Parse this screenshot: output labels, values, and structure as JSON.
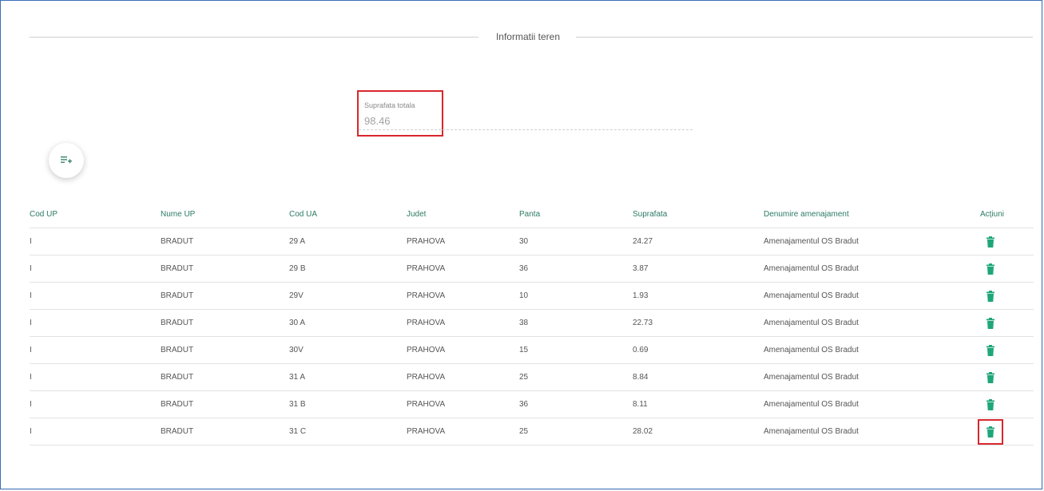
{
  "section": {
    "title": "Informatii teren"
  },
  "total_area": {
    "label": "Suprafata totala",
    "value": "98.46"
  },
  "add_button": {
    "icon": "playlist-add-icon"
  },
  "table": {
    "columns": [
      "Cod UP",
      "Nume UP",
      "Cod UA",
      "Judet",
      "Panta",
      "Suprafata",
      "Denumire amenajament",
      "Acțiuni"
    ],
    "rows": [
      {
        "cod_up": "I",
        "nume_up": "BRADUT",
        "cod_ua": "29 A",
        "judet": "PRAHOVA",
        "panta": "30",
        "suprafata": "24.27",
        "denumire": "Amenajamentul OS Bradut"
      },
      {
        "cod_up": "I",
        "nume_up": "BRADUT",
        "cod_ua": "29 B",
        "judet": "PRAHOVA",
        "panta": "36",
        "suprafata": "3.87",
        "denumire": "Amenajamentul OS Bradut"
      },
      {
        "cod_up": "I",
        "nume_up": "BRADUT",
        "cod_ua": "29V",
        "judet": "PRAHOVA",
        "panta": "10",
        "suprafata": "1.93",
        "denumire": "Amenajamentul OS Bradut"
      },
      {
        "cod_up": "I",
        "nume_up": "BRADUT",
        "cod_ua": "30 A",
        "judet": "PRAHOVA",
        "panta": "38",
        "suprafata": "22.73",
        "denumire": "Amenajamentul OS Bradut"
      },
      {
        "cod_up": "I",
        "nume_up": "BRADUT",
        "cod_ua": "30V",
        "judet": "PRAHOVA",
        "panta": "15",
        "suprafata": "0.69",
        "denumire": "Amenajamentul OS Bradut"
      },
      {
        "cod_up": "I",
        "nume_up": "BRADUT",
        "cod_ua": "31 A",
        "judet": "PRAHOVA",
        "panta": "25",
        "suprafata": "8.84",
        "denumire": "Amenajamentul OS Bradut"
      },
      {
        "cod_up": "I",
        "nume_up": "BRADUT",
        "cod_ua": "31 B",
        "judet": "PRAHOVA",
        "panta": "36",
        "suprafata": "8.11",
        "denumire": "Amenajamentul OS Bradut"
      },
      {
        "cod_up": "I",
        "nume_up": "BRADUT",
        "cod_ua": "31 C",
        "judet": "PRAHOVA",
        "panta": "25",
        "suprafata": "28.02",
        "denumire": "Amenajamentul OS Bradut"
      }
    ]
  },
  "colors": {
    "accent": "#2c7a64",
    "trash": "#1fa67a",
    "highlight": "#d9272d"
  }
}
